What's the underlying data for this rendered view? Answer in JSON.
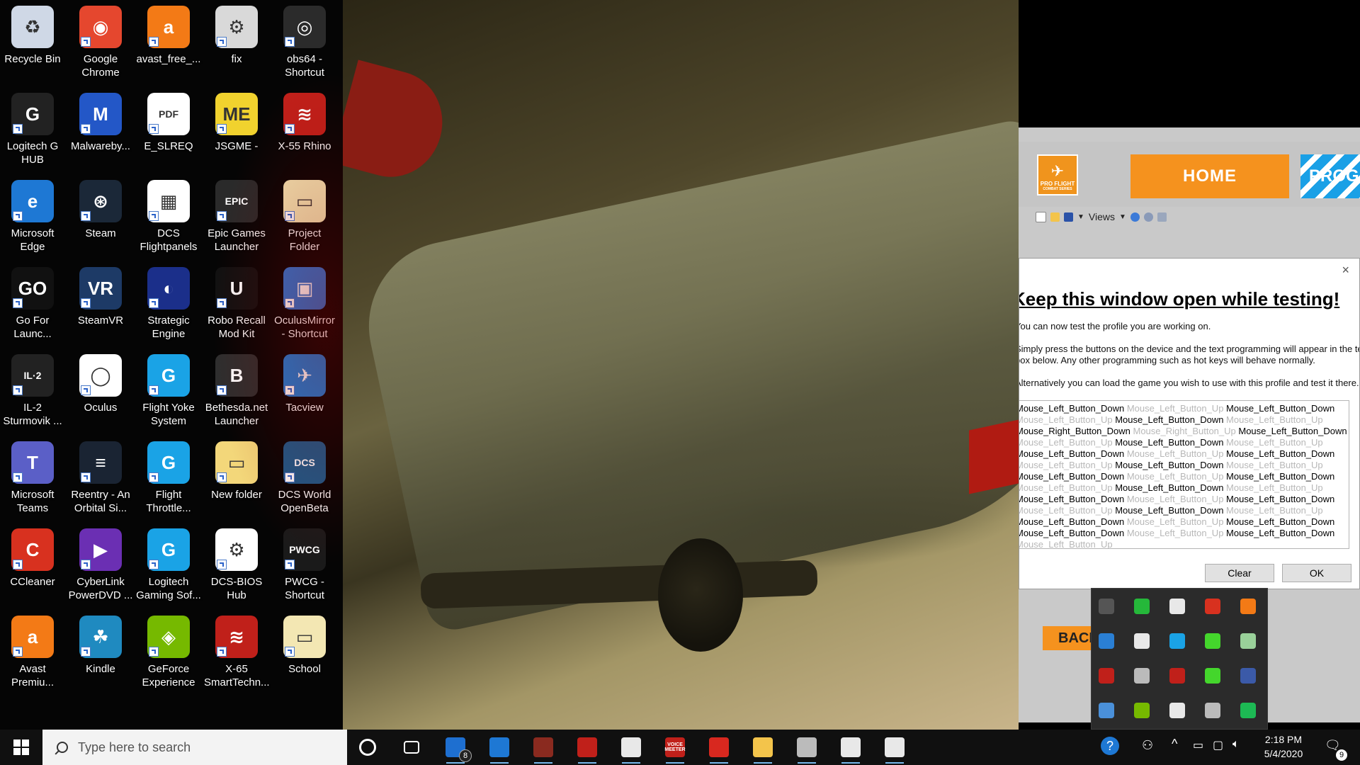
{
  "desktop": {
    "icons": [
      {
        "label": "Recycle Bin",
        "icon": "recycle-bin-icon",
        "color": "#cfd8e6",
        "col": 0,
        "row": 0
      },
      {
        "label": "Google\nChrome",
        "icon": "chrome-icon",
        "color": "#e5472e",
        "col": 1,
        "row": 0
      },
      {
        "label": "avast_free_...",
        "icon": "avast-icon",
        "color": "#f37a16",
        "col": 2,
        "row": 0
      },
      {
        "label": "fix",
        "icon": "settings-file-icon",
        "color": "#d9d9d9",
        "col": 3,
        "row": 0
      },
      {
        "label": "obs64 -\nShortcut",
        "icon": "obs-icon",
        "color": "#2b2b2b",
        "col": 4,
        "row": 0
      },
      {
        "label": "Logitech G\nHUB",
        "icon": "logitech-g-icon",
        "color": "#222222",
        "col": 0,
        "row": 1
      },
      {
        "label": "Malwareby...",
        "icon": "malwarebytes-icon",
        "color": "#2357c7",
        "col": 1,
        "row": 1
      },
      {
        "label": "E_SLREQ",
        "icon": "pdf-icon",
        "color": "#ffffff",
        "col": 2,
        "row": 1
      },
      {
        "label": "JSGME -",
        "icon": "jsgme-icon",
        "color": "#f1d22e",
        "col": 3,
        "row": 1
      },
      {
        "label": "X-55 Rhino",
        "icon": "saitek-icon",
        "color": "#c0201a",
        "col": 4,
        "row": 1
      },
      {
        "label": "Microsoft\nEdge",
        "icon": "edge-icon",
        "color": "#1e78d4",
        "col": 0,
        "row": 2
      },
      {
        "label": "Steam",
        "icon": "steam-icon",
        "color": "#1b2838",
        "col": 1,
        "row": 2
      },
      {
        "label": "DCS\nFlightpanels",
        "icon": "dcs-flightpanels-icon",
        "color": "#ffffff",
        "col": 2,
        "row": 2
      },
      {
        "label": "Epic Games\nLauncher",
        "icon": "epic-games-icon",
        "color": "#2a2a2a",
        "col": 3,
        "row": 2
      },
      {
        "label": "Project\nFolder",
        "icon": "folder-icon",
        "color": "#f3e7b3",
        "col": 4,
        "row": 2
      },
      {
        "label": "Go For\nLaunc...",
        "icon": "go-for-launch-icon",
        "color": "#111111",
        "col": 0,
        "row": 3
      },
      {
        "label": "SteamVR",
        "icon": "steamvr-icon",
        "color": "#1d3a66",
        "col": 1,
        "row": 3
      },
      {
        "label": "Strategic\nEngine",
        "icon": "strategic-engine-icon",
        "color": "#1b2f8a",
        "col": 2,
        "row": 3
      },
      {
        "label": "Robo Recall\nMod Kit",
        "icon": "unreal-icon",
        "color": "#111111",
        "col": 3,
        "row": 3
      },
      {
        "label": "OculusMirror\n- Shortcut",
        "icon": "oculus-mirror-icon",
        "color": "#2b76d3",
        "col": 4,
        "row": 3
      },
      {
        "label": "IL-2\nSturmovik ...",
        "icon": "il2-icon",
        "color": "#222222",
        "col": 0,
        "row": 4
      },
      {
        "label": "Oculus",
        "icon": "oculus-icon",
        "color": "#ffffff",
        "col": 1,
        "row": 4
      },
      {
        "label": "Flight Yoke\nSystem",
        "icon": "logitech-g-blue-icon",
        "color": "#1aa3e6",
        "col": 2,
        "row": 4
      },
      {
        "label": "Bethesda.net\nLauncher",
        "icon": "bethesda-icon",
        "color": "#2e2e2e",
        "col": 3,
        "row": 4
      },
      {
        "label": "Tacview",
        "icon": "tacview-icon",
        "color": "#1c7ed6",
        "col": 4,
        "row": 4
      },
      {
        "label": "Microsoft\nTeams",
        "icon": "teams-icon",
        "color": "#5b5fc7",
        "col": 0,
        "row": 5
      },
      {
        "label": "Reentry - An\nOrbital Si...",
        "icon": "reentry-icon",
        "color": "#1a2433",
        "col": 1,
        "row": 5
      },
      {
        "label": "Flight\nThrottle...",
        "icon": "logitech-g-blue-icon",
        "color": "#1aa3e6",
        "col": 2,
        "row": 5
      },
      {
        "label": "New folder",
        "icon": "folder-icon",
        "color": "#f3d77a",
        "col": 3,
        "row": 5
      },
      {
        "label": "DCS World\nOpenBeta",
        "icon": "dcs-world-icon",
        "color": "#1b5a8a",
        "col": 4,
        "row": 5
      },
      {
        "label": "CCleaner",
        "icon": "ccleaner-icon",
        "color": "#d8311f",
        "col": 0,
        "row": 6
      },
      {
        "label": "CyberLink\nPowerDVD ...",
        "icon": "powerdvd-icon",
        "color": "#6b2fb3",
        "col": 1,
        "row": 6
      },
      {
        "label": "Logitech\nGaming Sof...",
        "icon": "logitech-g-blue-icon",
        "color": "#1aa3e6",
        "col": 2,
        "row": 6
      },
      {
        "label": "DCS-BIOS\nHub",
        "icon": "dcs-bios-icon",
        "color": "#ffffff",
        "col": 3,
        "row": 6
      },
      {
        "label": "PWCG -\nShortcut",
        "icon": "pwcg-icon",
        "color": "#1a1a1a",
        "col": 4,
        "row": 6
      },
      {
        "label": "Avast\nPremiu...",
        "icon": "avast-icon",
        "color": "#f37a16",
        "col": 0,
        "row": 7
      },
      {
        "label": "Kindle",
        "icon": "kindle-icon",
        "color": "#1f8ac0",
        "col": 1,
        "row": 7
      },
      {
        "label": "GeForce\nExperience",
        "icon": "geforce-icon",
        "color": "#76b900",
        "col": 2,
        "row": 7
      },
      {
        "label": "X-65\nSmartTechn...",
        "icon": "saitek-icon",
        "color": "#c0201a",
        "col": 3,
        "row": 7
      },
      {
        "label": "School",
        "icon": "folder-icon",
        "color": "#f3e7b3",
        "col": 4,
        "row": 7
      }
    ]
  },
  "app": {
    "logo_text": "PRO FLIGHT",
    "logo_sub": "COMBAT SERIES",
    "nav_home": "HOME",
    "nav_prog": "PROG",
    "toolbar_views": "Views",
    "back_label": "BACK"
  },
  "dialog": {
    "close": "×",
    "title": "Keep this window open while testing!",
    "line1": "You can now test the profile you are working on.",
    "line2a": "Simply press the buttons on the device and the text programming will appear in the text",
    "line2b": "box below. Any other programming such as hot keys will behave normally.",
    "line3": "Alternatively you can load the game you wish to use with this profile and test it there.",
    "log": [
      [
        {
          "t": "Mouse_Left_Button_Down",
          "k": "dn"
        },
        {
          "t": "Mouse_Left_Button_Up",
          "k": "up"
        },
        {
          "t": "Mouse_Left_Button_Down",
          "k": "dn"
        }
      ],
      [
        {
          "t": "Mouse_Left_Button_Up",
          "k": "up"
        },
        {
          "t": "Mouse_Left_Button_Down",
          "k": "dn"
        },
        {
          "t": "Mouse_Left_Button_Up",
          "k": "up"
        }
      ],
      [
        {
          "t": "Mouse_Right_Button_Down",
          "k": "dn"
        },
        {
          "t": "Mouse_Right_Button_Up",
          "k": "up"
        },
        {
          "t": "Mouse_Left_Button_Down",
          "k": "dn"
        }
      ],
      [
        {
          "t": "Mouse_Left_Button_Up",
          "k": "up"
        },
        {
          "t": "Mouse_Left_Button_Down",
          "k": "dn"
        },
        {
          "t": "Mouse_Left_Button_Up",
          "k": "up"
        }
      ],
      [
        {
          "t": "Mouse_Left_Button_Down",
          "k": "dn"
        },
        {
          "t": "Mouse_Left_Button_Up",
          "k": "up"
        },
        {
          "t": "Mouse_Left_Button_Down",
          "k": "dn"
        }
      ],
      [
        {
          "t": "Mouse_Left_Button_Up",
          "k": "up"
        },
        {
          "t": "Mouse_Left_Button_Down",
          "k": "dn"
        },
        {
          "t": "Mouse_Left_Button_Up",
          "k": "up"
        }
      ],
      [
        {
          "t": "Mouse_Left_Button_Down",
          "k": "dn"
        },
        {
          "t": "Mouse_Left_Button_Up",
          "k": "up"
        },
        {
          "t": "Mouse_Left_Button_Down",
          "k": "dn"
        }
      ],
      [
        {
          "t": "Mouse_Left_Button_Up",
          "k": "up"
        },
        {
          "t": "Mouse_Left_Button_Down",
          "k": "dn"
        },
        {
          "t": "Mouse_Left_Button_Up",
          "k": "up"
        }
      ],
      [
        {
          "t": "Mouse_Left_Button_Down",
          "k": "dn"
        },
        {
          "t": "Mouse_Left_Button_Up",
          "k": "up"
        },
        {
          "t": "Mouse_Left_Button_Down",
          "k": "dn"
        }
      ],
      [
        {
          "t": "Mouse_Left_Button_Up",
          "k": "up"
        },
        {
          "t": "Mouse_Left_Button_Down",
          "k": "dn"
        },
        {
          "t": "Mouse_Left_Button_Up",
          "k": "up"
        }
      ],
      [
        {
          "t": "Mouse_Left_Button_Down",
          "k": "dn"
        },
        {
          "t": "Mouse_Left_Button_Up",
          "k": "up"
        },
        {
          "t": "Mouse_Left_Button_Down",
          "k": "dn"
        }
      ],
      [
        {
          "t": "Mouse_Left_Button_Down",
          "k": "dn"
        },
        {
          "t": "Mouse_Left_Button_Up",
          "k": "up"
        },
        {
          "t": "Mouse_Left_Button_Down",
          "k": "dn"
        }
      ],
      [
        {
          "t": "Mouse_Left_Button_Up",
          "k": "up"
        }
      ]
    ],
    "clear_label": "Clear",
    "ok_label": "OK"
  },
  "tray_popup": {
    "icons": [
      {
        "name": "usb-icon",
        "color": "#555555"
      },
      {
        "name": "gpu-z-icon",
        "color": "#25b83a"
      },
      {
        "name": "security-shield-icon",
        "color": "#e8e8e8"
      },
      {
        "name": "ccleaner-tray-icon",
        "color": "#d8311f"
      },
      {
        "name": "avast-tray-icon",
        "color": "#f37a16"
      },
      {
        "name": "tool-icon",
        "color": "#2a7fd4"
      },
      {
        "name": "microphone-icon",
        "color": "#e8e8e8"
      },
      {
        "name": "logitech-g-tray-icon",
        "color": "#1aa3e6"
      },
      {
        "name": "razer-icon",
        "color": "#44d62c"
      },
      {
        "name": "network-drive-icon",
        "color": "#9ad19a"
      },
      {
        "name": "voicemeeter-icon",
        "color": "#c0201a"
      },
      {
        "name": "pen-icon",
        "color": "#bbbbbb"
      },
      {
        "name": "saitek-tray-icon",
        "color": "#c0201a"
      },
      {
        "name": "razer-cortex-icon",
        "color": "#44d62c"
      },
      {
        "name": "app-tray-icon",
        "color": "#3b5aa8"
      },
      {
        "name": "shield-tray-icon",
        "color": "#4a90d9"
      },
      {
        "name": "nvidia-icon",
        "color": "#76b900"
      },
      {
        "name": "logitech-ghub-tray-icon",
        "color": "#e8e8e8"
      },
      {
        "name": "x-tray-icon",
        "color": "#bbbbbb"
      },
      {
        "name": "green-app-icon",
        "color": "#1db954"
      }
    ]
  },
  "taskbar": {
    "search_placeholder": "Type here to search",
    "mail_badge": "8",
    "voicemeeter_label": "VOICE MEETER",
    "apps": [
      {
        "name": "cortana-icon",
        "color": "#101010"
      },
      {
        "name": "task-view-icon",
        "color": "#101010"
      },
      {
        "name": "mail-icon",
        "color": "#1e6fd0"
      },
      {
        "name": "edge-taskbar-icon",
        "color": "#1e78d4"
      },
      {
        "name": "antivirus-taskbar-icon",
        "color": "#8a2a1f"
      },
      {
        "name": "saitek-taskbar-icon",
        "color": "#c0201a"
      },
      {
        "name": "store-icon",
        "color": "#e8e8e8"
      },
      {
        "name": "voicemeeter-taskbar-icon",
        "color": "#c0201a"
      },
      {
        "name": "acrobat-icon",
        "color": "#d8281f"
      },
      {
        "name": "file-explorer-icon",
        "color": "#f3c44b"
      },
      {
        "name": "steam-taskbar-icon",
        "color": "#bbbbbb"
      },
      {
        "name": "settings-taskbar-icon",
        "color": "#e8e8e8"
      },
      {
        "name": "oculus-taskbar-icon",
        "color": "#e8e8e8"
      }
    ],
    "time": "2:18 PM",
    "date": "5/4/2020",
    "notification_count": "9"
  }
}
